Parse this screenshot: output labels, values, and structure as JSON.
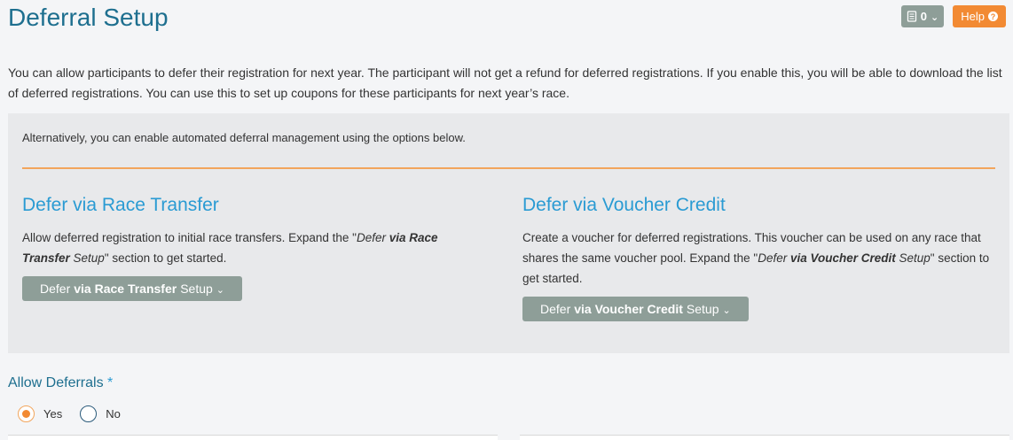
{
  "header": {
    "title": "Deferral Setup",
    "count": "0",
    "help_label": "Help"
  },
  "intro": {
    "text": "You can allow participants to defer their registration for next year. The participant will not get a refund for deferred registrations. If you enable this, you will be able to download the list of deferred registrations. You can use this to set up coupons for these participants for next year’s race."
  },
  "panel": {
    "alt_text": "Alternatively, you can enable automated deferral management using the options below.",
    "race_transfer": {
      "title": "Defer via Race Transfer",
      "desc_prefix": "Allow deferred registration to initial race transfers. Expand the \"",
      "desc_em_a": "Defer ",
      "desc_strong": "via Race Transfer",
      "desc_em_b": " Setup",
      "desc_suffix": "\" section to get started.",
      "btn_pre": "Defer ",
      "btn_bold": "via Race Transfer",
      "btn_post": " Setup"
    },
    "voucher_credit": {
      "title": "Defer via Voucher Credit",
      "desc_prefix": "Create a voucher for deferred registrations. This voucher can be used on any race that shares the same voucher pool. Expand the \"",
      "desc_em_a": "Defer ",
      "desc_strong": "via Voucher Credit",
      "desc_em_b": " Setup",
      "desc_suffix": "\" section to get started.",
      "btn_pre": "Defer ",
      "btn_bold": "via Voucher Credit",
      "btn_post": " Setup"
    }
  },
  "allow_deferrals": {
    "label": "Allow Deferrals",
    "required_mark": "*",
    "options": [
      "Yes",
      "No"
    ],
    "selected": "Yes"
  }
}
